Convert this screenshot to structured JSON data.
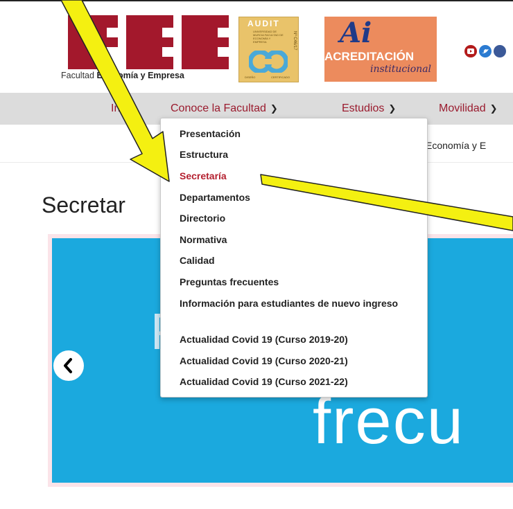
{
  "header": {
    "logo": {
      "caption_pre": "Facultad",
      "caption_bold": "Economía y Empresa",
      "mark": "FEE"
    },
    "audit_badge": {
      "title": "AUDIT",
      "subtitle": "UNIVERSIDAD DE MURCIA FACULTAD DE ECONOMÍA Y EMPRESA",
      "number": "Nº C46/17",
      "footer_left": "DISEÑO",
      "footer_right": "CERTIFICADO"
    },
    "acreditacion": {
      "ai": "Ai",
      "title": "ACREDITACIÓN",
      "subtitle": "institucional"
    },
    "social_icons": [
      "youtube-icon",
      "twitter-icon",
      "facebook-icon"
    ]
  },
  "nav": {
    "items": [
      {
        "label": "Inicio"
      },
      {
        "label": "Conoce la Facultad",
        "has_chevron": true
      },
      {
        "label": "Estudios",
        "has_chevron": true
      },
      {
        "label": "Movilidad",
        "has_chevron": true
      }
    ]
  },
  "breadcrumb": {
    "text": "Economía y E"
  },
  "page": {
    "title": "Secretar"
  },
  "carousel": {
    "text_top": "P",
    "text_bottom": "frecu"
  },
  "dropdown": {
    "items": [
      {
        "label": "Presentación"
      },
      {
        "label": "Estructura"
      },
      {
        "label": "Secretaría",
        "active": true
      },
      {
        "label": "Departamentos"
      },
      {
        "label": "Directorio"
      },
      {
        "label": "Normativa"
      },
      {
        "label": "Calidad"
      },
      {
        "label": "Preguntas frecuentes"
      },
      {
        "label": "Información para estudiantes de nuevo ingreso"
      },
      {
        "label": "Actualidad Covid 19 (Curso 2019-20)"
      },
      {
        "label": "Actualidad Covid 19 (Curso 2020-21)"
      },
      {
        "label": "Actualidad Covid 19 (Curso 2021-22)"
      }
    ]
  },
  "colors": {
    "brand": "#9a1b2e",
    "active_link": "#b4202f",
    "nav_bg": "#dcdcdc",
    "carousel_bg": "#1ba9de",
    "arrow_fill": "#f4f011"
  }
}
